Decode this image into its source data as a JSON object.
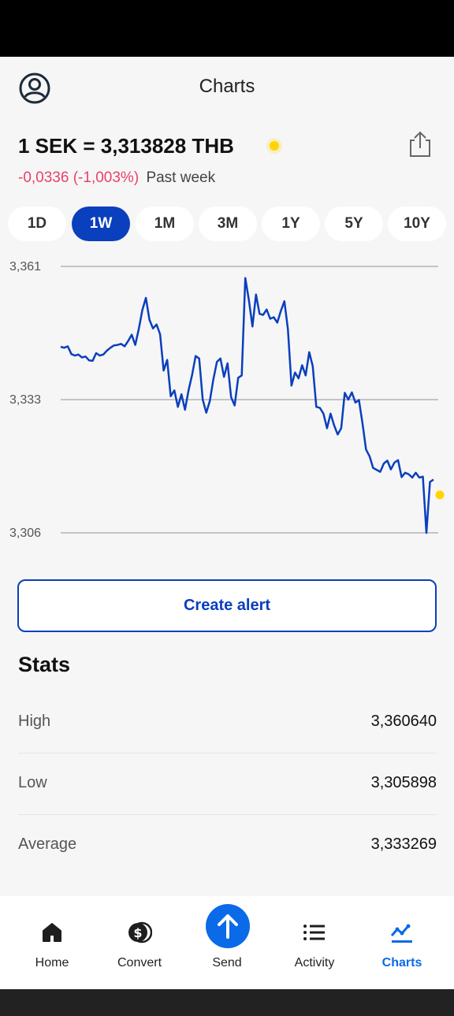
{
  "header": {
    "title": "Charts",
    "avatar_icon": "user-circle-icon",
    "share_icon": "share-icon"
  },
  "rate": {
    "text": "1 SEK = 3,313828 THB",
    "change": "-0,0336 (-1,003%)",
    "period": "Past week"
  },
  "ranges": [
    {
      "label": "1D",
      "active": false
    },
    {
      "label": "1W",
      "active": true
    },
    {
      "label": "1M",
      "active": false
    },
    {
      "label": "3M",
      "active": false
    },
    {
      "label": "1Y",
      "active": false
    },
    {
      "label": "5Y",
      "active": false
    },
    {
      "label": "10Y",
      "active": false
    }
  ],
  "chart_data": {
    "type": "line",
    "y_ticks": [
      "3,361",
      "3,333",
      "3,306"
    ],
    "ylim": [
      3.306,
      3.361
    ],
    "grid": true,
    "line_color": "#0a3fbd",
    "marker_color": "#ffd400",
    "series": [
      {
        "values": [
          3.3444,
          3.3442,
          3.3445,
          3.3429,
          3.3426,
          3.3428,
          3.3422,
          3.3424,
          3.3416,
          3.3415,
          3.3431,
          3.3426,
          3.3428,
          3.3436,
          3.3442,
          3.3447,
          3.3448,
          3.345,
          3.3445,
          3.3456,
          3.3469,
          3.3448,
          3.3481,
          3.352,
          3.3545,
          3.35,
          3.3482,
          3.349,
          3.347,
          3.3395,
          3.3417,
          3.3342,
          3.3354,
          3.332,
          3.3346,
          3.3314,
          3.3354,
          3.3386,
          3.3425,
          3.342,
          3.3335,
          3.3308,
          3.3332,
          3.3377,
          3.3413,
          3.342,
          3.3382,
          3.341,
          3.334,
          3.3323,
          3.338,
          3.3385,
          3.3586,
          3.354,
          3.3486,
          3.3552,
          3.3512,
          3.351,
          3.3521,
          3.3502,
          3.3505,
          3.3494,
          3.3518,
          3.3538,
          3.348,
          3.3364,
          3.3391,
          3.3379,
          3.3406,
          3.3385,
          3.3433,
          3.3404,
          3.332,
          3.3318,
          3.3306,
          3.3276,
          3.3306,
          3.3282,
          3.3263,
          3.3276,
          3.3349,
          3.3335,
          3.335,
          3.3329,
          3.3334,
          3.3286,
          3.3232,
          3.3218,
          3.3194,
          3.319,
          3.3186,
          3.3203,
          3.3209,
          3.3191,
          3.3205,
          3.321,
          3.3175,
          3.3184,
          3.3181,
          3.3174,
          3.3184,
          3.3174,
          3.3176,
          3.306,
          3.3165,
          3.317
        ]
      }
    ],
    "current_value": 3.313828
  },
  "create_alert_label": "Create alert",
  "stats": {
    "title": "Stats",
    "rows": [
      {
        "label": "High",
        "value": "3,360640"
      },
      {
        "label": "Low",
        "value": "3,305898"
      },
      {
        "label": "Average",
        "value": "3,333269"
      }
    ]
  },
  "nav": [
    {
      "label": "Home",
      "icon": "home-icon",
      "active": false
    },
    {
      "label": "Convert",
      "icon": "convert-icon",
      "active": false
    },
    {
      "label": "Send",
      "icon": "send-arrow-icon",
      "active": false
    },
    {
      "label": "Activity",
      "icon": "activity-list-icon",
      "active": false
    },
    {
      "label": "Charts",
      "icon": "charts-icon",
      "active": true
    }
  ]
}
